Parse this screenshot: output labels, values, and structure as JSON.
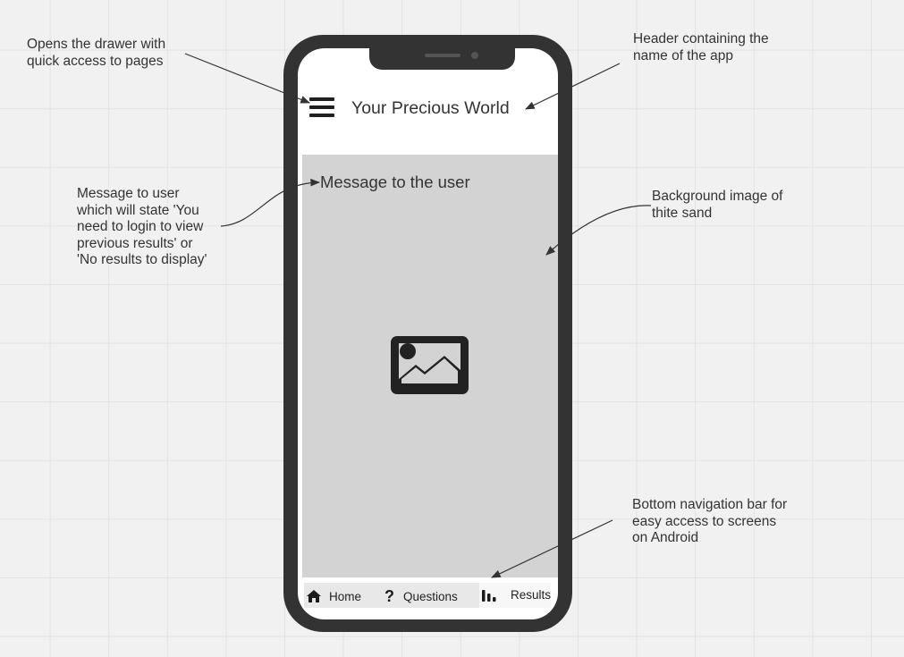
{
  "annotations": {
    "drawer": "Opens the drawer with\nquick access to pages",
    "header": "Header containing the\nname of the app",
    "message": "Message to user\nwhich will state 'You\nneed to login to view\nprevious results' or\n'No results to display'",
    "background": "Background image of\nthite sand",
    "bottom_nav": "Bottom navigation bar for\neasy access to screens\non Android"
  },
  "app": {
    "title": "Your Precious World",
    "user_message": "Message to the user"
  },
  "bottom_nav": {
    "items": [
      {
        "label": "Home",
        "icon": "home-icon"
      },
      {
        "label": "Questions",
        "icon": "question-icon"
      },
      {
        "label": "Results",
        "icon": "bar-chart-icon"
      }
    ]
  },
  "icons": {
    "menu": "hamburger-menu-icon",
    "background": "image-placeholder-icon"
  },
  "colors": {
    "phone_frame": "#333333",
    "placeholder": "#d3d3d3",
    "canvas": "#f1f1f1"
  }
}
